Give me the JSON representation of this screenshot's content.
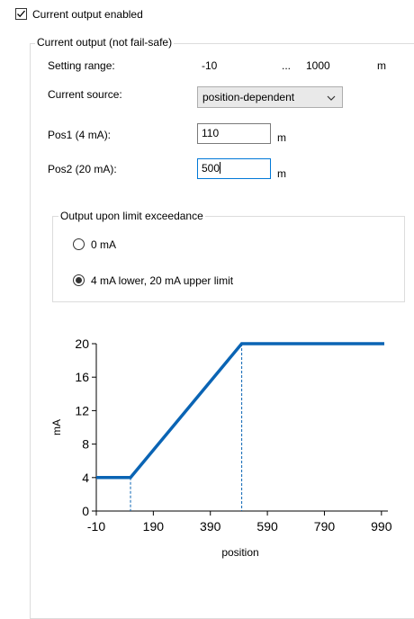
{
  "current_output_enabled": {
    "label": "Current output enabled",
    "checked": true
  },
  "group": {
    "title": "Current output (not fail-safe)",
    "setting_range": {
      "label": "Setting range:",
      "min": "-10",
      "sep": "...",
      "max": "1000",
      "unit": "m"
    },
    "current_source": {
      "label": "Current source:",
      "value": "position-dependent"
    },
    "pos1": {
      "label": "Pos1 (4 mA):",
      "value": "110",
      "unit": "m"
    },
    "pos2": {
      "label": "Pos2 (20 mA):",
      "value": "500",
      "unit": "m"
    }
  },
  "limit_group": {
    "title": "Output upon limit exceedance",
    "options": [
      {
        "label": "0 mA",
        "selected": false
      },
      {
        "label": "4 mA lower, 20 mA upper limit",
        "selected": true
      }
    ]
  },
  "chart_data": {
    "type": "line",
    "xlabel": "position",
    "ylabel": "mA",
    "xlim": [
      -10,
      1000
    ],
    "ylim": [
      0,
      20
    ],
    "xticks": [
      -10,
      190,
      390,
      590,
      790,
      990
    ],
    "yticks": [
      0,
      4,
      8,
      12,
      16,
      20
    ],
    "series": [
      {
        "x": [
          -10,
          110,
          500,
          1000
        ],
        "y": [
          4,
          4,
          20,
          20
        ]
      }
    ],
    "markers": [
      {
        "x": 110,
        "y": 4
      },
      {
        "x": 500,
        "y": 20
      }
    ],
    "line_color": "#0a64b4",
    "grid": false
  }
}
